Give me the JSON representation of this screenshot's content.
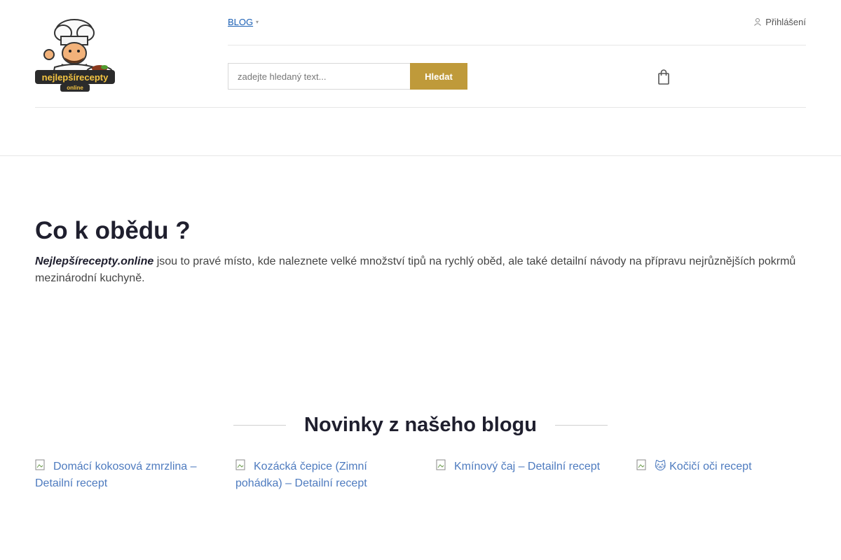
{
  "header": {
    "logo_alt": "nejlepsirecepty online",
    "logo_text_top": "nejlepšírecepty",
    "logo_text_bottom": "online",
    "nav": {
      "blog_label": "BLOG"
    },
    "login_label": "Přihlášení",
    "search": {
      "placeholder": "zadejte hledaný text...",
      "button_label": "Hledat"
    }
  },
  "hero": {
    "title": "Co k obědu ?",
    "brand": "Nejlepšírecepty.online",
    "text": " jsou to pravé místo, kde naleznete velké množství tipů na rychlý oběd, ale také detailní návody na přípravu nejrůznějších pokrmů mezinárodní kuchyně."
  },
  "blog": {
    "heading": "Novinky z našeho blogu",
    "posts": [
      {
        "title": "Domácí kokosová zmrzlina – Detailní recept"
      },
      {
        "title": "Kozácká čepice (Zimní pohádka) – Detailní recept"
      },
      {
        "title": "Kmínový čaj – Detailní recept"
      },
      {
        "title": "🐱 Kočičí oči recept"
      }
    ]
  },
  "colors": {
    "accent": "#bf9a3a",
    "link": "#4e7bbf",
    "heading": "#1f1f2e"
  }
}
